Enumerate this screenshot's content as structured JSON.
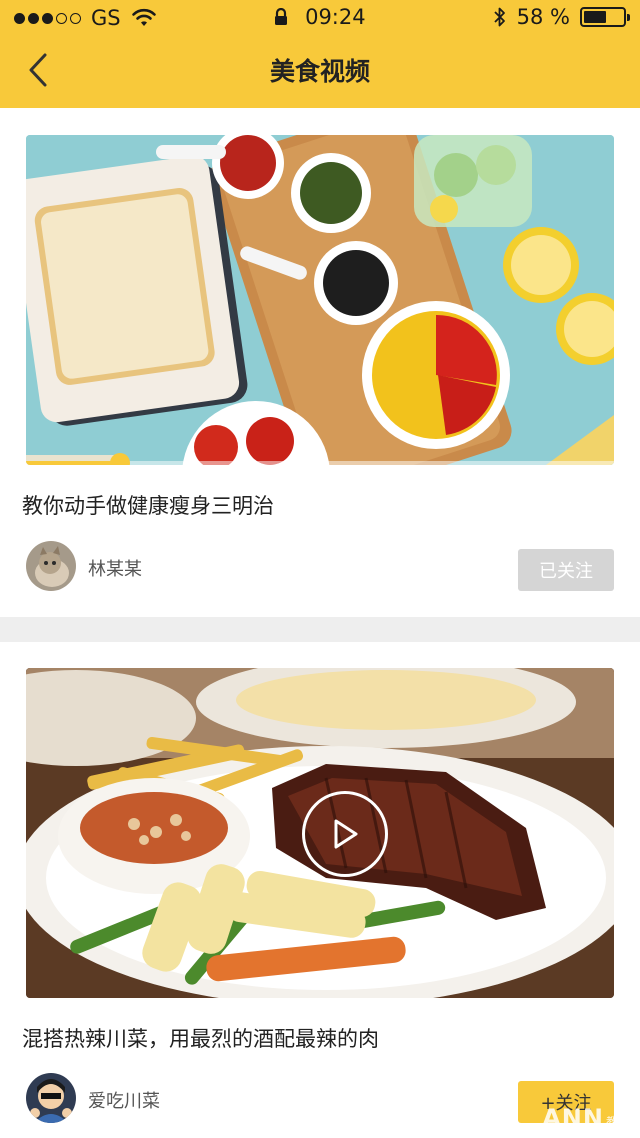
{
  "status_bar": {
    "carrier": "GS",
    "time": "09:24",
    "battery": "58 %",
    "battery_level": 0.58,
    "icons": [
      "signal-dots-icon",
      "wifi-icon",
      "lock-icon",
      "bluetooth-icon",
      "battery-icon"
    ]
  },
  "nav": {
    "title": "美食视频",
    "back_icon": "chevron-left-icon"
  },
  "videos": [
    {
      "title": "教你动手做健康瘦身三明治",
      "author": "林某某",
      "follow_label": "已关注",
      "followed": true,
      "progress": 0.16
    },
    {
      "title": "混搭热辣川菜，用最烈的酒配最辣的肉",
      "author": "爱吃川菜",
      "follow_label": "+关注",
      "followed": false,
      "play_icon": "play-icon"
    }
  ],
  "watermark": {
    "main": "ANN",
    "small": "教育"
  },
  "colors": {
    "accent": "#f8c93a",
    "followed_button": "#d5d5d5",
    "divider": "#eeeeee"
  }
}
